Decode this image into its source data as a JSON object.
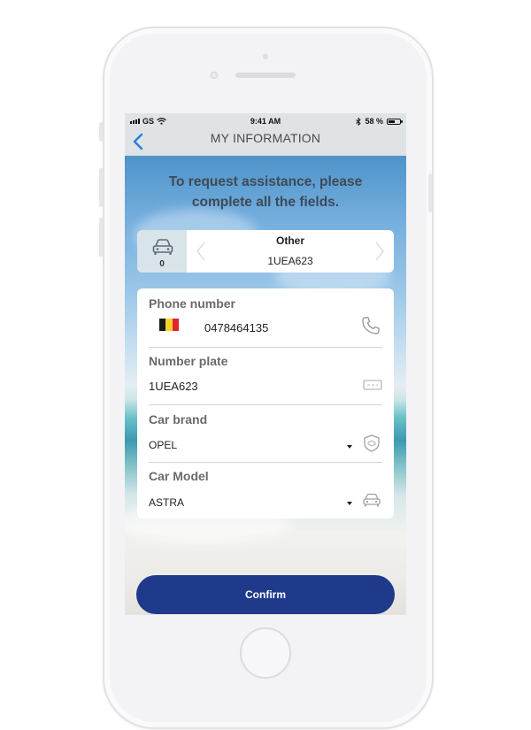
{
  "status_bar": {
    "carrier": "GS",
    "time": "9:41 AM",
    "battery_percent": "58 %",
    "battery_level": 0.58
  },
  "nav": {
    "title": "MY INFORMATION",
    "back_icon": "chevron-left-icon"
  },
  "intro": {
    "line1": "To request assistance, please",
    "line2": "complete all the fields."
  },
  "vehicle_selector": {
    "count": "0",
    "name": "Other",
    "plate": "1UEA623"
  },
  "form": {
    "phone": {
      "label": "Phone number",
      "value": "0478464135",
      "flag_colors": [
        "#1a1a1a",
        "#f6d12b",
        "#e3222b"
      ],
      "icon": "phone-icon"
    },
    "plate": {
      "label": "Number plate",
      "value": "1UEA623",
      "icon": "license-plate-icon"
    },
    "brand": {
      "label": "Car brand",
      "value": "OPEL",
      "icon": "brand-shield-icon"
    },
    "model": {
      "label": "Car Model",
      "value": "ASTRA",
      "icon": "car-icon"
    }
  },
  "confirm_button": {
    "label": "Confirm",
    "color": "#1f3a8a"
  },
  "colors": {
    "accent": "#1f3a8a",
    "back_arrow": "#2a7de1"
  }
}
